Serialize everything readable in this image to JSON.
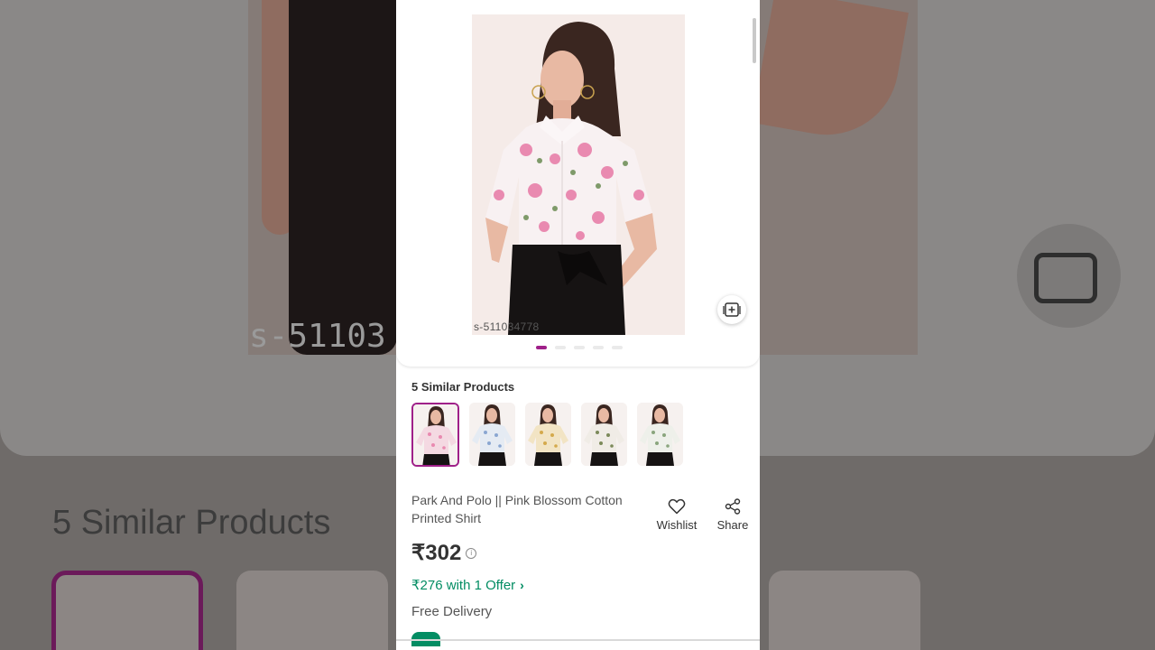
{
  "product": {
    "image_code": "s-511034778",
    "name": "Park And Polo || Pink Blossom Cotton Printed Shirt",
    "price": "₹302",
    "offer_text": "₹276 with 1 Offer",
    "delivery": "Free Delivery"
  },
  "carousel": {
    "total": 5,
    "active_index": 0
  },
  "similar": {
    "title": "5 Similar Products",
    "items": [
      {
        "shirt_color": "#f4d9e2",
        "print_color": "#e98ab0"
      },
      {
        "shirt_color": "#e5ebf3",
        "print_color": "#8aa6d1"
      },
      {
        "shirt_color": "#f2e4c4",
        "print_color": "#d4a94c"
      },
      {
        "shirt_color": "#f0ece6",
        "print_color": "#7c8a5a"
      },
      {
        "shirt_color": "#eef0ea",
        "print_color": "#8aa57d"
      }
    ]
  },
  "actions": {
    "wishlist_label": "Wishlist",
    "share_label": "Share"
  },
  "backdrop": {
    "heading": "5 Similar Products",
    "code": "s-51103"
  },
  "colors": {
    "accent": "#9f2089",
    "offer_green": "#038d63"
  },
  "icons": [
    "collage-icon",
    "heart-icon",
    "share-icon",
    "info-icon",
    "chevron-right-icon"
  ]
}
